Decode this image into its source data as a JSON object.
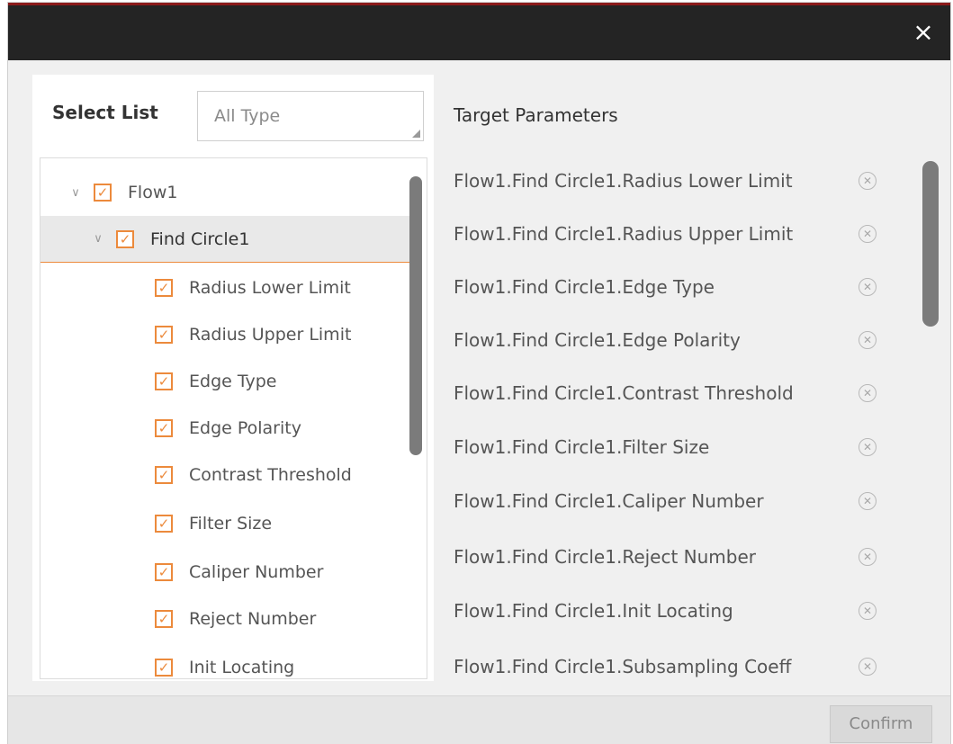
{
  "titlebar": {
    "close_icon": "×"
  },
  "left": {
    "select_label": "Select List",
    "type_filter": "All Type",
    "tree": {
      "root": {
        "label": "Flow1",
        "checked": true,
        "expanded": true
      },
      "group": {
        "label": "Find Circle1",
        "checked": true,
        "expanded": true,
        "selected": true
      },
      "items": [
        {
          "label": "Radius Lower Limit",
          "checked": true
        },
        {
          "label": "Radius Upper Limit",
          "checked": true
        },
        {
          "label": "Edge Type",
          "checked": true
        },
        {
          "label": "Edge Polarity",
          "checked": true
        },
        {
          "label": "Contrast Threshold",
          "checked": true
        },
        {
          "label": "Filter Size",
          "checked": true
        },
        {
          "label": "Caliper Number",
          "checked": true
        },
        {
          "label": "Reject Number",
          "checked": true
        },
        {
          "label": "Init Locating",
          "checked": true
        }
      ]
    }
  },
  "right": {
    "title": "Target Parameters",
    "params": [
      "Flow1.Find Circle1.Radius Lower Limit",
      "Flow1.Find Circle1.Radius Upper Limit",
      "Flow1.Find Circle1.Edge Type",
      "Flow1.Find Circle1.Edge Polarity",
      "Flow1.Find Circle1.Contrast Threshold",
      "Flow1.Find Circle1.Filter Size",
      "Flow1.Find Circle1.Caliper Number",
      "Flow1.Find Circle1.Reject Number",
      "Flow1.Find Circle1.Init Locating",
      "Flow1.Find Circle1.Subsampling Coeff"
    ]
  },
  "footer": {
    "confirm_label": "Confirm"
  },
  "colors": {
    "accent": "#ec8a3c",
    "titlebar": "#242424",
    "title_top_border": "#8b1a1a"
  }
}
